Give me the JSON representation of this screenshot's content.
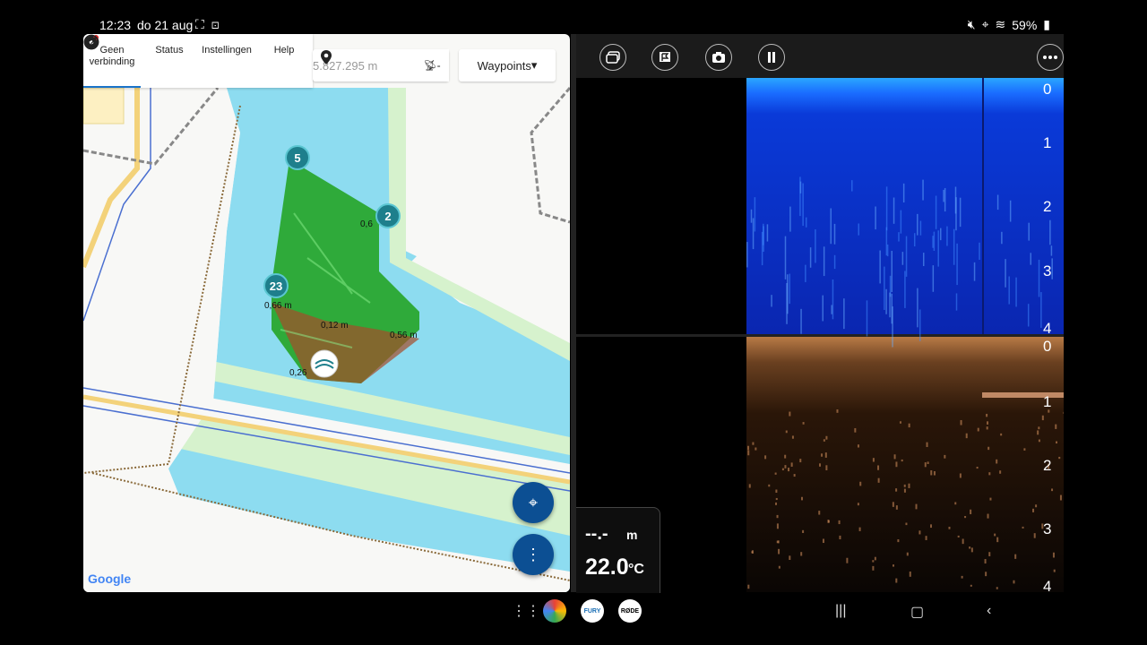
{
  "status_bar": {
    "time": "12:23",
    "date": "do 21 aug",
    "battery": "59%"
  },
  "map": {
    "menu": [
      {
        "label": "Geen verbinding",
        "icon": "no-connection-icon"
      },
      {
        "label": "Status",
        "icon": "info-icon"
      },
      {
        "label": "Instellingen",
        "icon": "gear-icon"
      },
      {
        "label": "Help",
        "icon": "help-icon"
      }
    ],
    "location_value": "5.827.295 m",
    "gps_suffix": "-",
    "waypoints_label": "Waypoints",
    "waypoints": [
      "5",
      "2",
      "23"
    ],
    "depth_labels": [
      "0,6",
      "0,66 m",
      "0,12 m",
      "0,56 m",
      "0,26"
    ],
    "attribution": "Google"
  },
  "sonar": {
    "toolbar": [
      "screen-icon",
      "flag-icon",
      "camera-icon",
      "pause-icon",
      "more-icon"
    ],
    "top_scale": [
      "0",
      "1",
      "2",
      "3",
      "4"
    ],
    "bottom_scale": [
      "0",
      "1",
      "2",
      "3",
      "4"
    ],
    "depth_readout": "--.-",
    "depth_unit": "m",
    "temperature": "22.0",
    "temp_unit": "°C"
  },
  "dock": {
    "apps": [
      "photos-icon",
      "fury-icon",
      "rode-icon"
    ],
    "app_labels": [
      "FURY",
      "RØDE"
    ]
  },
  "colors": {
    "water": "#8ddcf0",
    "land": "#f8f8f6",
    "park": "#d6f2cd",
    "fab": "#0c4f93",
    "waypoint": "#1e7f8c"
  }
}
